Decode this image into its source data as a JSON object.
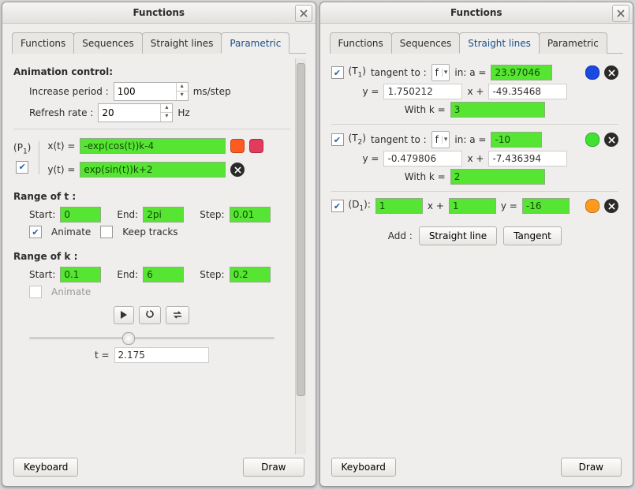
{
  "left": {
    "title": "Functions",
    "tabs": [
      "Functions",
      "Sequences",
      "Straight lines",
      "Parametric"
    ],
    "activeTab": 3,
    "animCtrl": {
      "header": "Animation control:",
      "incLabel": "Increase period :",
      "incValue": "100",
      "incUnit": "ms/step",
      "refLabel": "Refresh rate :",
      "refValue": "20",
      "refUnit": "Hz"
    },
    "param": {
      "name": "P",
      "sub": "1",
      "xLbl": "x(t) =",
      "xVal": "-exp(cos(t))k-4",
      "yLbl": "y(t) =",
      "yVal": "exp(sin(t))k+2",
      "color1": "#ff5a1f",
      "color2": "#e23b5b"
    },
    "rangeT": {
      "header": "Range of t :",
      "startL": "Start:",
      "startV": "0",
      "endL": "End:",
      "endV": "2pi",
      "stepL": "Step:",
      "stepV": "0.01",
      "animL": "Animate",
      "keepL": "Keep tracks"
    },
    "rangeK": {
      "header": "Range of k :",
      "startL": "Start:",
      "startV": "0.1",
      "endL": "End:",
      "endV": "6",
      "stepL": "Step:",
      "stepV": "0.2",
      "animL": "Animate"
    },
    "tLabel": "t =",
    "tVal": "2.175",
    "sliderPos": 0.38,
    "footer": {
      "kbd": "Keyboard",
      "draw": "Draw"
    }
  },
  "right": {
    "title": "Functions",
    "tabs": [
      "Functions",
      "Sequences",
      "Straight lines",
      "Parametric"
    ],
    "activeTab": 2,
    "tangent1": {
      "name": "T",
      "sub": "1",
      "label": "tangent to :",
      "func": "f",
      "inL": "in: a =",
      "a": "23.97046",
      "yEq": "y =",
      "m": "1.750212",
      "xPlus": "x +",
      "b": "-49.35468",
      "withK": "With k =",
      "k": "3",
      "swatch": "#1a4ae0"
    },
    "tangent2": {
      "name": "T",
      "sub": "2",
      "label": "tangent to :",
      "func": "f",
      "inL": "in: a =",
      "a": "-10",
      "yEq": "y =",
      "m": "-0.479806",
      "xPlus": "x +",
      "b": "-7.436394",
      "withK": "With k =",
      "k": "2",
      "swatch": "#3fe233"
    },
    "line1": {
      "name": "D",
      "sub": "1",
      "xcoef": "1",
      "xPlus": "x +",
      "ycoef": "1",
      "yEq": "y =",
      "c": "-16",
      "swatch": "#ff9a1f"
    },
    "add": {
      "label": "Add :",
      "straight": "Straight line",
      "tangent": "Tangent"
    },
    "footer": {
      "kbd": "Keyboard",
      "draw": "Draw"
    }
  }
}
